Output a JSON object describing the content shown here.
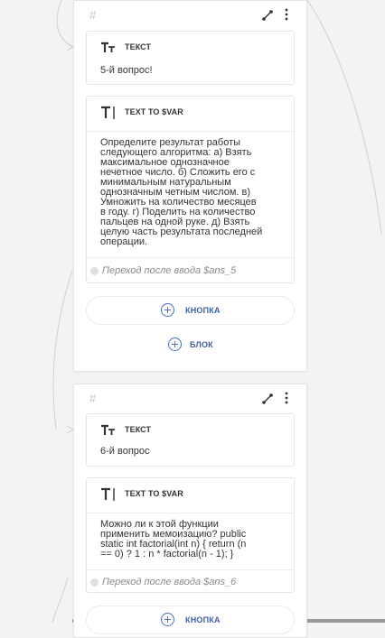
{
  "colors": {
    "accent": "#3e5ea8",
    "canvas": "#f3f3f3",
    "card_border": "#e6e6e6"
  },
  "nodes": [
    {
      "hash": "#",
      "cards": [
        {
          "type": "ТЕКСТ",
          "icon": "text-type-icon",
          "text": "5-й вопрос!"
        },
        {
          "type": "TEXT TO $VAR",
          "icon": "text-cursor-icon",
          "lines": [
            "Определите результат работы",
            "следующего алгоритма:  а) Взять",
            "максимальное однозначное",
            "нечетное число.  б) Сложить его с",
            "минимальным натуральным",
            "однозначным четным числом.  в)",
            "Умножить на количество месяцев",
            "в году.  г) Поделить на количество",
            "пальцев на одной руке.  д) Взять",
            "целую часть результата последней",
            "операции."
          ],
          "transition": "Переход после ввода $ans_5"
        }
      ],
      "button_label": "КНОПКА",
      "block_label": "БЛОК"
    },
    {
      "hash": "#",
      "cards": [
        {
          "type": "ТЕКСТ",
          "icon": "text-type-icon",
          "text": "6-й вопрос"
        },
        {
          "type": "TEXT TO $VAR",
          "icon": "text-cursor-icon",
          "lines": [
            "Можно ли к этой функции",
            "применить мемоизацию? public",
            "static int factorial(int n) {  return (n",
            "== 0) ? 1 : n * factorial(n - 1);  }"
          ],
          "transition": "Переход после ввода $ans_6"
        }
      ],
      "button_label": "КНОПКА"
    }
  ]
}
